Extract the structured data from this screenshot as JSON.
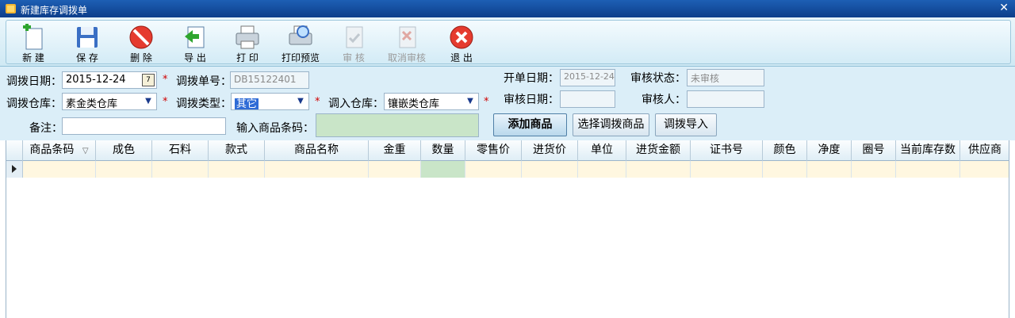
{
  "window": {
    "title": "新建库存调拨单",
    "close_glyph": "✕"
  },
  "toolbar": {
    "buttons": [
      {
        "label": "新 建",
        "icon": "new-icon",
        "enabled": true
      },
      {
        "label": "保 存",
        "icon": "save-icon",
        "enabled": true
      },
      {
        "label": "删 除",
        "icon": "delete-icon",
        "enabled": true
      },
      {
        "label": "导 出",
        "icon": "export-icon",
        "enabled": true
      },
      {
        "label": "打 印",
        "icon": "print-icon",
        "enabled": true
      },
      {
        "label": "打印预览",
        "icon": "print-preview-icon",
        "enabled": true
      },
      {
        "label": "审 核",
        "icon": "audit-icon",
        "enabled": false
      },
      {
        "label": "取消审核",
        "icon": "cancel-audit-icon",
        "enabled": false
      },
      {
        "label": "退 出",
        "icon": "exit-icon",
        "enabled": true
      }
    ]
  },
  "form": {
    "transfer_date_label": "调拨日期：",
    "transfer_date_value": "2015-12-24",
    "transfer_no_label": "调拨单号：",
    "transfer_no_value": "DB15122401",
    "open_date_label": "开单日期：",
    "open_date_value": "2015-12-24",
    "audit_status_label": "审核状态：",
    "audit_status_value": "未审核",
    "out_warehouse_label": "调拨仓库：",
    "out_warehouse_value": "素金类仓库",
    "transfer_type_label": "调拨类型：",
    "transfer_type_value": "其它",
    "in_warehouse_label": "调入仓库：",
    "in_warehouse_value": "镶嵌类仓库",
    "audit_date_label": "审核日期：",
    "audit_date_value": "",
    "auditor_label": "审核人：",
    "auditor_value": "",
    "remark_label": "备注：",
    "remark_value": "",
    "barcode_label": "输入商品条码：",
    "barcode_value": "",
    "required_mark": "*",
    "add_goods_button": "添加商品",
    "select_goods_button": "选择调拨商品",
    "import_button": "调拨导入"
  },
  "grid": {
    "columns": [
      "商品条码",
      "成色",
      "石料",
      "款式",
      "商品名称",
      "金重",
      "数量",
      "零售价",
      "进货价",
      "单位",
      "进货金额",
      "证书号",
      "颜色",
      "净度",
      "圈号",
      "当前库存数",
      "供应商"
    ],
    "sort_glyph": "▽"
  },
  "colors": {
    "title_bar": "#1d5fb4",
    "form_bg": "#dbeef8",
    "row_highlight": "#fff7e0",
    "qty_cell": "#c9e5c8",
    "required": "#d00000"
  }
}
